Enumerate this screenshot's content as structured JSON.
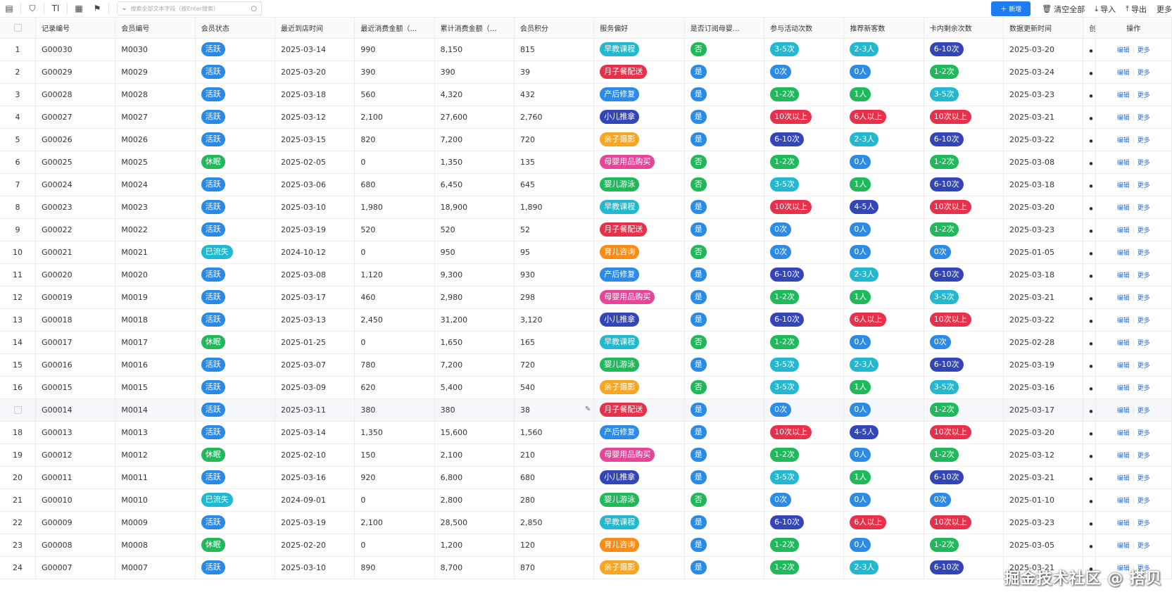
{
  "toolbar": {
    "search_placeholder": "搜索全部文本字段（按Enter搜索）",
    "new_label": "新增",
    "clear_label": "清空全部",
    "import_label": "导入",
    "export_label": "导出",
    "more_label": "更多"
  },
  "columns": [
    "记录编号",
    "会员编号",
    "会员状态",
    "最近到店时间",
    "最近消费金额（…",
    "累计消费金额（…",
    "会员积分",
    "服务偏好",
    "是否订阅母婴…",
    "参与活动次数",
    "推荐新客数",
    "卡内剩余次数",
    "数据更新时间",
    "创"
  ],
  "op_header": "操作",
  "op_edit": "编辑",
  "op_more": "更多",
  "colors": {
    "活跃": "#2b8ae6",
    "休眠": "#1fb85a",
    "已流失": "#22b8cf",
    "早教课程": "#22b8cf",
    "月子餐配送": "#e8304a",
    "产后修复": "#2b8ae6",
    "小儿推拿": "#3346b8",
    "亲子摄影": "#f5a623",
    "母婴用品购买": "#e8459a",
    "婴儿游泳": "#1fb85a",
    "育儿咨询": "#fa8c16",
    "是": "#2b8ae6",
    "否": "#1fb85a",
    "0次": "#2b8ae6",
    "1-2次": "#1fb85a",
    "3-5次": "#22b8cf",
    "6-10次": "#3346b8",
    "10次以上": "#e8304a",
    "0人": "#2b8ae6",
    "1人": "#1fb85a",
    "2-3人": "#22b8cf",
    "4-5人": "#3346b8",
    "6人以上": "#e8304a"
  },
  "rows": [
    {
      "idx": "1",
      "rec": "G00030",
      "mem": "M0030",
      "status": "活跃",
      "last": "2025-03-14",
      "recent": "990",
      "total": "8,150",
      "points": "815",
      "pref": "早教课程",
      "sub": "否",
      "act": "3-5次",
      "ref": "2-3人",
      "card": "6-10次",
      "upd": "2025-03-20"
    },
    {
      "idx": "2",
      "rec": "G00029",
      "mem": "M0029",
      "status": "活跃",
      "last": "2025-03-20",
      "recent": "390",
      "total": "390",
      "points": "39",
      "pref": "月子餐配送",
      "sub": "是",
      "act": "0次",
      "ref": "0人",
      "card": "1-2次",
      "upd": "2025-03-24"
    },
    {
      "idx": "3",
      "rec": "G00028",
      "mem": "M0028",
      "status": "活跃",
      "last": "2025-03-18",
      "recent": "560",
      "total": "4,320",
      "points": "432",
      "pref": "产后修复",
      "sub": "是",
      "act": "1-2次",
      "ref": "1人",
      "card": "3-5次",
      "upd": "2025-03-23"
    },
    {
      "idx": "4",
      "rec": "G00027",
      "mem": "M0027",
      "status": "活跃",
      "last": "2025-03-12",
      "recent": "2,100",
      "total": "27,600",
      "points": "2,760",
      "pref": "小儿推拿",
      "sub": "是",
      "act": "10次以上",
      "ref": "6人以上",
      "card": "10次以上",
      "upd": "2025-03-21"
    },
    {
      "idx": "5",
      "rec": "G00026",
      "mem": "M0026",
      "status": "活跃",
      "last": "2025-03-15",
      "recent": "820",
      "total": "7,200",
      "points": "720",
      "pref": "亲子摄影",
      "sub": "是",
      "act": "6-10次",
      "ref": "2-3人",
      "card": "6-10次",
      "upd": "2025-03-22"
    },
    {
      "idx": "6",
      "rec": "G00025",
      "mem": "M0025",
      "status": "休眠",
      "last": "2025-02-05",
      "recent": "0",
      "total": "1,350",
      "points": "135",
      "pref": "母婴用品购买",
      "sub": "否",
      "act": "1-2次",
      "ref": "0人",
      "card": "1-2次",
      "upd": "2025-03-08"
    },
    {
      "idx": "7",
      "rec": "G00024",
      "mem": "M0024",
      "status": "活跃",
      "last": "2025-03-06",
      "recent": "680",
      "total": "6,450",
      "points": "645",
      "pref": "婴儿游泳",
      "sub": "否",
      "act": "3-5次",
      "ref": "1人",
      "card": "6-10次",
      "upd": "2025-03-18"
    },
    {
      "idx": "8",
      "rec": "G00023",
      "mem": "M0023",
      "status": "活跃",
      "last": "2025-03-10",
      "recent": "1,980",
      "total": "18,900",
      "points": "1,890",
      "pref": "早教课程",
      "sub": "是",
      "act": "10次以上",
      "ref": "4-5人",
      "card": "10次以上",
      "upd": "2025-03-20"
    },
    {
      "idx": "9",
      "rec": "G00022",
      "mem": "M0022",
      "status": "活跃",
      "last": "2025-03-19",
      "recent": "520",
      "total": "520",
      "points": "52",
      "pref": "月子餐配送",
      "sub": "是",
      "act": "0次",
      "ref": "0人",
      "card": "1-2次",
      "upd": "2025-03-23"
    },
    {
      "idx": "10",
      "rec": "G00021",
      "mem": "M0021",
      "status": "已流失",
      "last": "2024-10-12",
      "recent": "0",
      "total": "950",
      "points": "95",
      "pref": "育儿咨询",
      "sub": "否",
      "act": "0次",
      "ref": "0人",
      "card": "0次",
      "upd": "2025-01-05"
    },
    {
      "idx": "11",
      "rec": "G00020",
      "mem": "M0020",
      "status": "活跃",
      "last": "2025-03-08",
      "recent": "1,120",
      "total": "9,300",
      "points": "930",
      "pref": "产后修复",
      "sub": "是",
      "act": "6-10次",
      "ref": "2-3人",
      "card": "6-10次",
      "upd": "2025-03-18"
    },
    {
      "idx": "12",
      "rec": "G00019",
      "mem": "M0019",
      "status": "活跃",
      "last": "2025-03-17",
      "recent": "460",
      "total": "2,980",
      "points": "298",
      "pref": "母婴用品购买",
      "sub": "是",
      "act": "1-2次",
      "ref": "1人",
      "card": "3-5次",
      "upd": "2025-03-21"
    },
    {
      "idx": "13",
      "rec": "G00018",
      "mem": "M0018",
      "status": "活跃",
      "last": "2025-03-13",
      "recent": "2,450",
      "total": "31,200",
      "points": "3,120",
      "pref": "小儿推拿",
      "sub": "是",
      "act": "6-10次",
      "ref": "6人以上",
      "card": "10次以上",
      "upd": "2025-03-22"
    },
    {
      "idx": "14",
      "rec": "G00017",
      "mem": "M0017",
      "status": "休眠",
      "last": "2025-01-25",
      "recent": "0",
      "total": "1,650",
      "points": "165",
      "pref": "早教课程",
      "sub": "否",
      "act": "1-2次",
      "ref": "0人",
      "card": "0次",
      "upd": "2025-02-28"
    },
    {
      "idx": "15",
      "rec": "G00016",
      "mem": "M0016",
      "status": "活跃",
      "last": "2025-03-07",
      "recent": "780",
      "total": "7,200",
      "points": "720",
      "pref": "婴儿游泳",
      "sub": "是",
      "act": "3-5次",
      "ref": "2-3人",
      "card": "6-10次",
      "upd": "2025-03-19"
    },
    {
      "idx": "16",
      "rec": "G00015",
      "mem": "M0015",
      "status": "活跃",
      "last": "2025-03-09",
      "recent": "620",
      "total": "5,400",
      "points": "540",
      "pref": "亲子摄影",
      "sub": "否",
      "act": "3-5次",
      "ref": "1人",
      "card": "3-5次",
      "upd": "2025-03-16"
    },
    {
      "idx": "",
      "rec": "G00014",
      "mem": "M0014",
      "status": "活跃",
      "last": "2025-03-11",
      "recent": "380",
      "total": "380",
      "points": "38",
      "pref": "月子餐配送",
      "sub": "是",
      "act": "0次",
      "ref": "0人",
      "card": "1-2次",
      "upd": "2025-03-17",
      "hl": true
    },
    {
      "idx": "18",
      "rec": "G00013",
      "mem": "M0013",
      "status": "活跃",
      "last": "2025-03-14",
      "recent": "1,350",
      "total": "15,600",
      "points": "1,560",
      "pref": "产后修复",
      "sub": "是",
      "act": "10次以上",
      "ref": "4-5人",
      "card": "10次以上",
      "upd": "2025-03-20"
    },
    {
      "idx": "19",
      "rec": "G00012",
      "mem": "M0012",
      "status": "休眠",
      "last": "2025-02-10",
      "recent": "150",
      "total": "2,100",
      "points": "210",
      "pref": "母婴用品购买",
      "sub": "是",
      "act": "1-2次",
      "ref": "0人",
      "card": "1-2次",
      "upd": "2025-03-12"
    },
    {
      "idx": "20",
      "rec": "G00011",
      "mem": "M0011",
      "status": "活跃",
      "last": "2025-03-16",
      "recent": "920",
      "total": "6,800",
      "points": "680",
      "pref": "小儿推拿",
      "sub": "是",
      "act": "3-5次",
      "ref": "1人",
      "card": "6-10次",
      "upd": "2025-03-21"
    },
    {
      "idx": "21",
      "rec": "G00010",
      "mem": "M0010",
      "status": "已流失",
      "last": "2024-09-01",
      "recent": "0",
      "total": "2,800",
      "points": "280",
      "pref": "婴儿游泳",
      "sub": "否",
      "act": "0次",
      "ref": "0人",
      "card": "0次",
      "upd": "2025-01-10"
    },
    {
      "idx": "22",
      "rec": "G00009",
      "mem": "M0009",
      "status": "活跃",
      "last": "2025-03-19",
      "recent": "2,100",
      "total": "28,500",
      "points": "2,850",
      "pref": "早教课程",
      "sub": "是",
      "act": "6-10次",
      "ref": "6人以上",
      "card": "10次以上",
      "upd": "2025-03-23"
    },
    {
      "idx": "23",
      "rec": "G00008",
      "mem": "M0008",
      "status": "休眠",
      "last": "2025-02-20",
      "recent": "0",
      "total": "1,200",
      "points": "120",
      "pref": "育儿咨询",
      "sub": "是",
      "act": "1-2次",
      "ref": "0人",
      "card": "1-2次",
      "upd": "2025-03-05"
    },
    {
      "idx": "24",
      "rec": "G00007",
      "mem": "M0007",
      "status": "活跃",
      "last": "2025-03-10",
      "recent": "890",
      "total": "8,700",
      "points": "870",
      "pref": "亲子摄影",
      "sub": "是",
      "act": "1-2次",
      "ref": "2-3人",
      "card": "6-10次",
      "upd": "2025-03-21"
    }
  ],
  "watermark": "掘金技术社区 @ 搭贝"
}
